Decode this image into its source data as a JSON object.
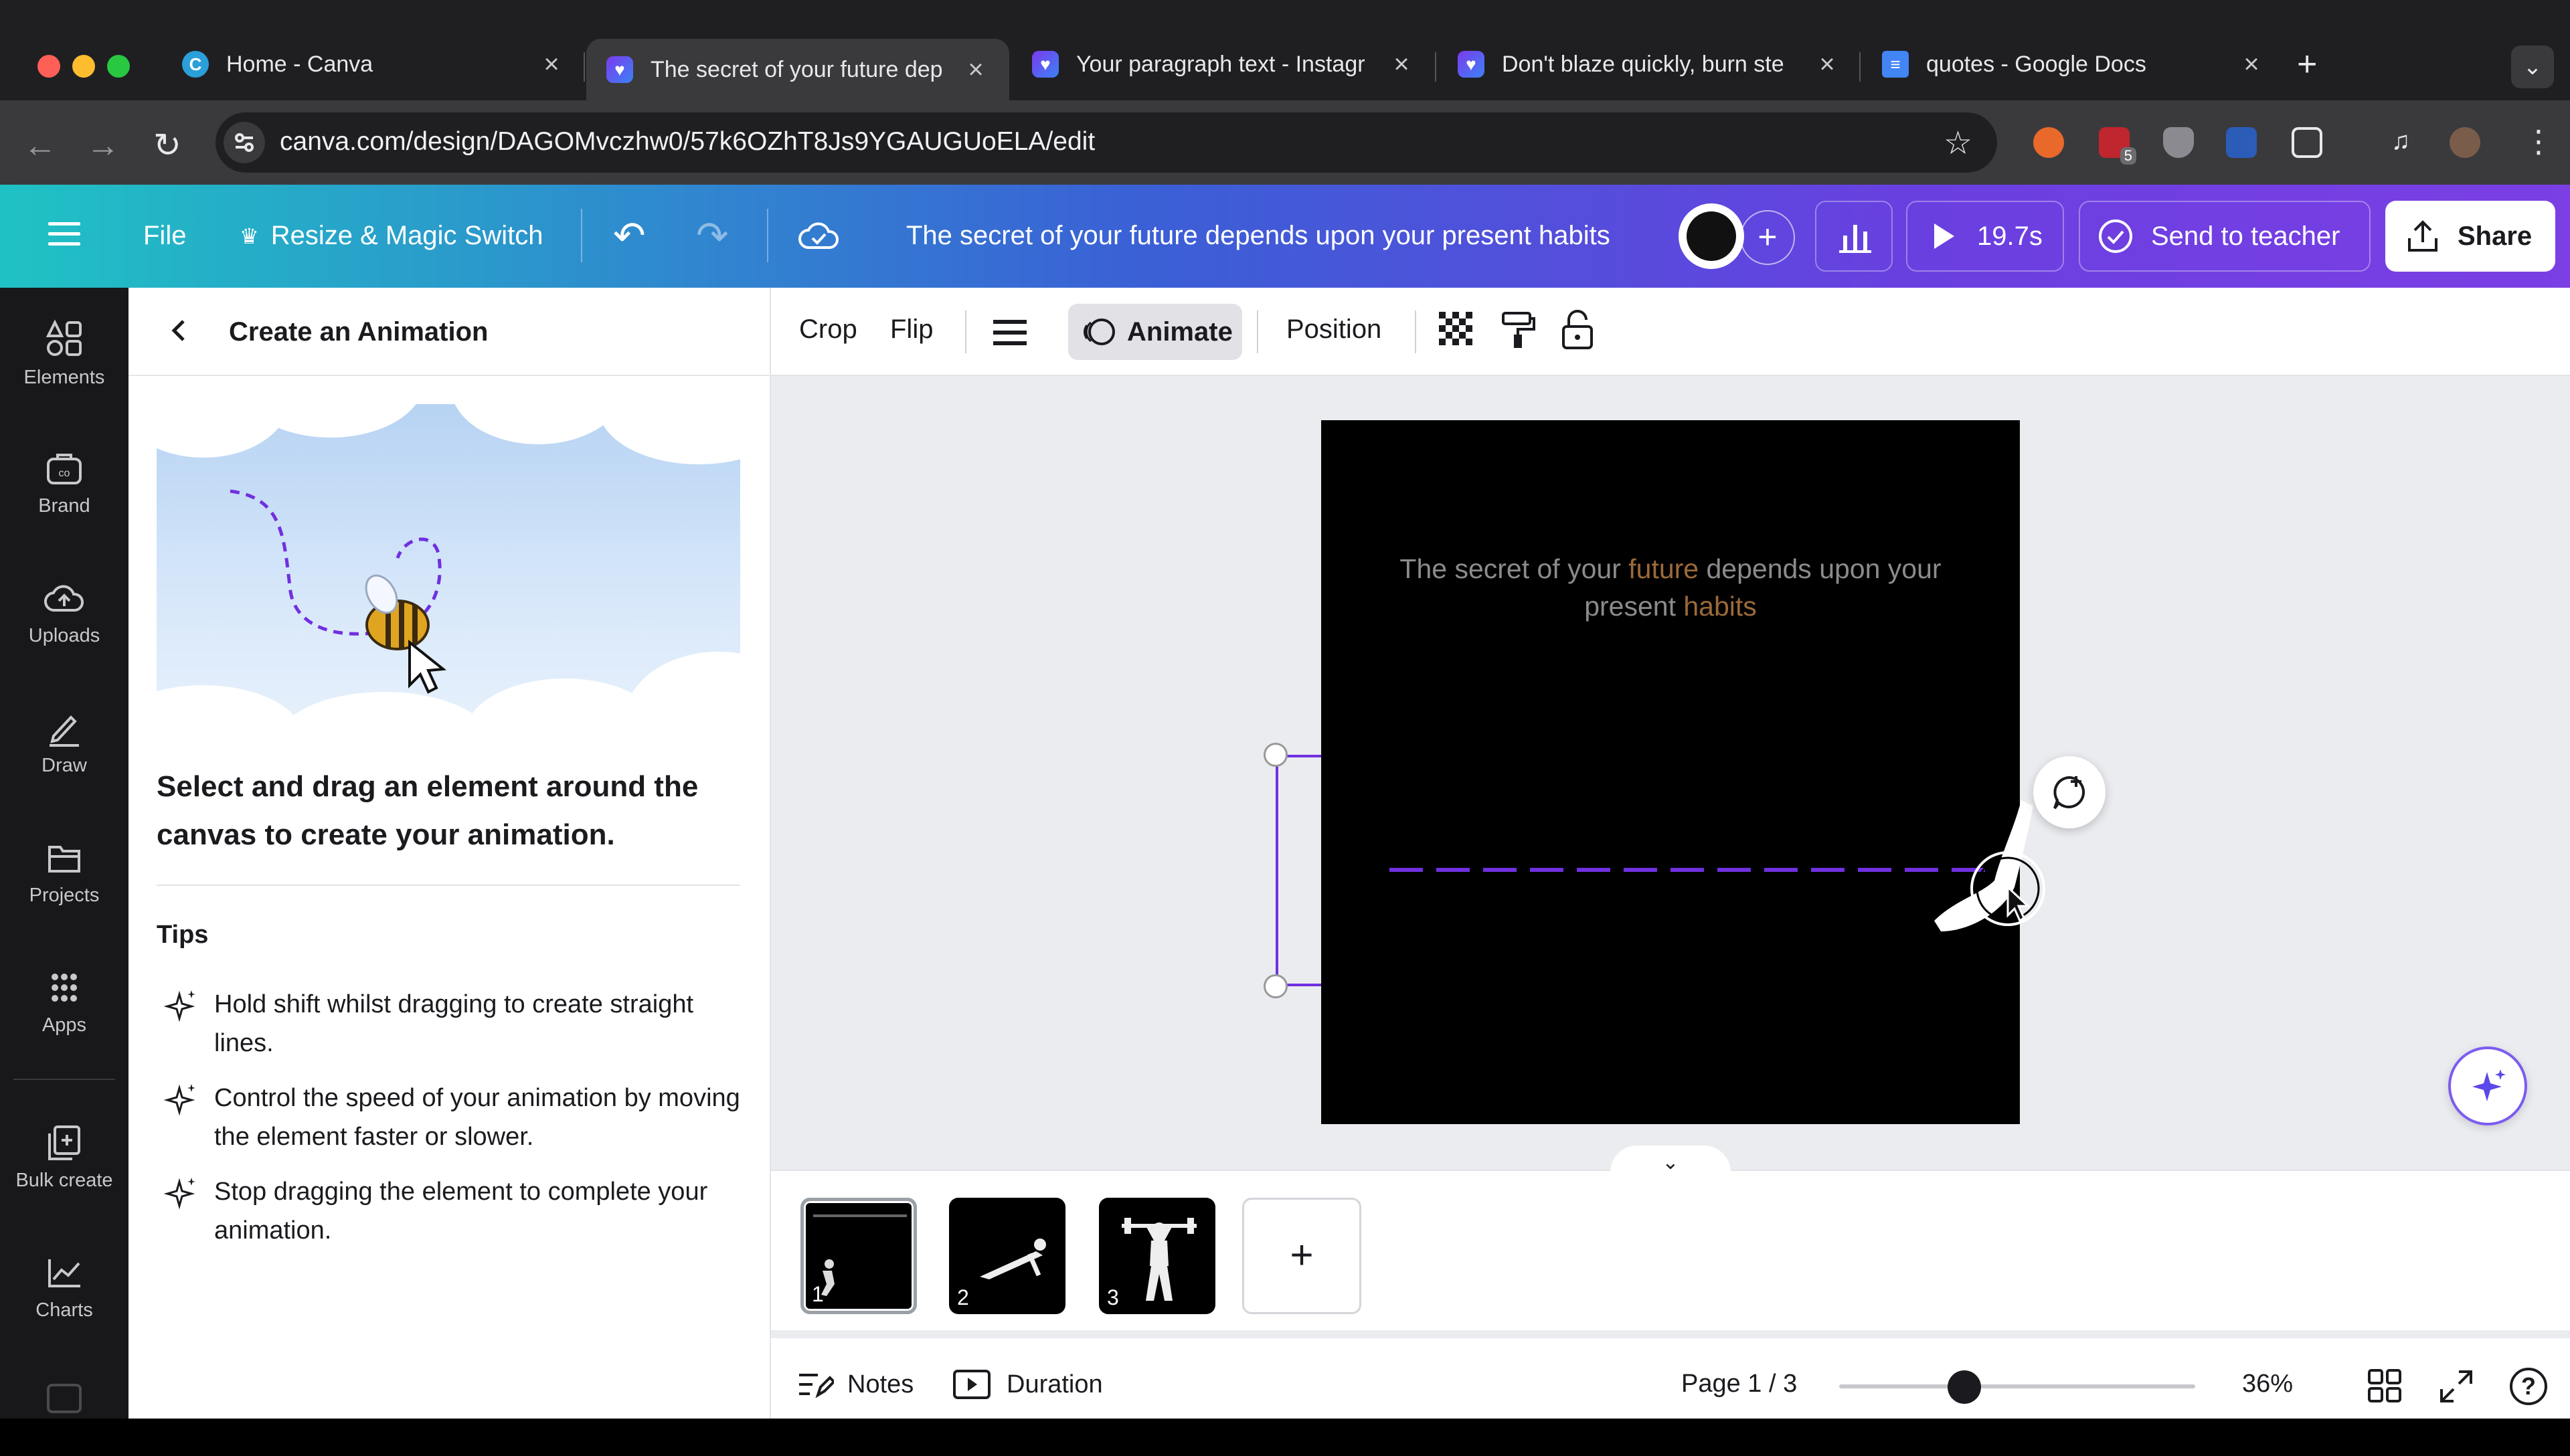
{
  "browser": {
    "tabs": [
      {
        "title": "Home - Canva",
        "favicon": "canva-icon",
        "active": false
      },
      {
        "title": "The secret of your future dep",
        "favicon": "heart-icon",
        "active": true
      },
      {
        "title": "Your paragraph text - Instagr",
        "favicon": "heart-icon",
        "active": false
      },
      {
        "title": "Don't blaze quickly, burn ste",
        "favicon": "heart-icon",
        "active": false
      },
      {
        "title": "quotes - Google Docs",
        "favicon": "docs-icon",
        "active": false
      }
    ],
    "url": "canva.com/design/DAGOMvczhw0/57k6OZhT8Js9YGAUGUoELA/edit",
    "extension_badge": "5"
  },
  "canva_bar": {
    "file": "File",
    "resize": "Resize & Magic Switch",
    "design_title": "The secret of your future depends upon your present habits",
    "play_duration": "19.7s",
    "send_to_teacher": "Send to teacher",
    "share": "Share"
  },
  "rail": {
    "items": [
      {
        "label": "Elements",
        "icon": "elements-icon"
      },
      {
        "label": "Brand",
        "icon": "brand-icon"
      },
      {
        "label": "Uploads",
        "icon": "uploads-icon"
      },
      {
        "label": "Draw",
        "icon": "draw-icon"
      },
      {
        "label": "Projects",
        "icon": "projects-icon"
      },
      {
        "label": "Apps",
        "icon": "apps-icon"
      },
      {
        "label": "Bulk create",
        "icon": "bulk-create-icon"
      },
      {
        "label": "Charts",
        "icon": "charts-icon"
      }
    ]
  },
  "panel": {
    "title": "Create an Animation",
    "instruction": "Select and drag an element around the canvas to create your animation.",
    "tips_heading": "Tips",
    "tips": [
      "Hold shift whilst dragging to create straight lines.",
      "Control the speed of your animation by moving the element faster or slower.",
      "Stop dragging the element to complete your animation."
    ]
  },
  "context_toolbar": {
    "crop": "Crop",
    "flip": "Flip",
    "animate": "Animate",
    "position": "Position"
  },
  "canvas": {
    "quote_part1": "The secret of your ",
    "quote_hl1": "future",
    "quote_part2": " depends upon your",
    "quote_part3": "present ",
    "quote_hl2": "habits"
  },
  "pages": {
    "thumbs": [
      "1",
      "2",
      "3"
    ],
    "add_label": "+"
  },
  "bottom_bar": {
    "notes": "Notes",
    "duration": "Duration",
    "page_indicator": "Page 1 / 3",
    "zoom_level": 0.36,
    "zoom": "36%"
  },
  "colors": {
    "accent_purple": "#7030e0",
    "highlight_text": "#9b6a3a"
  }
}
